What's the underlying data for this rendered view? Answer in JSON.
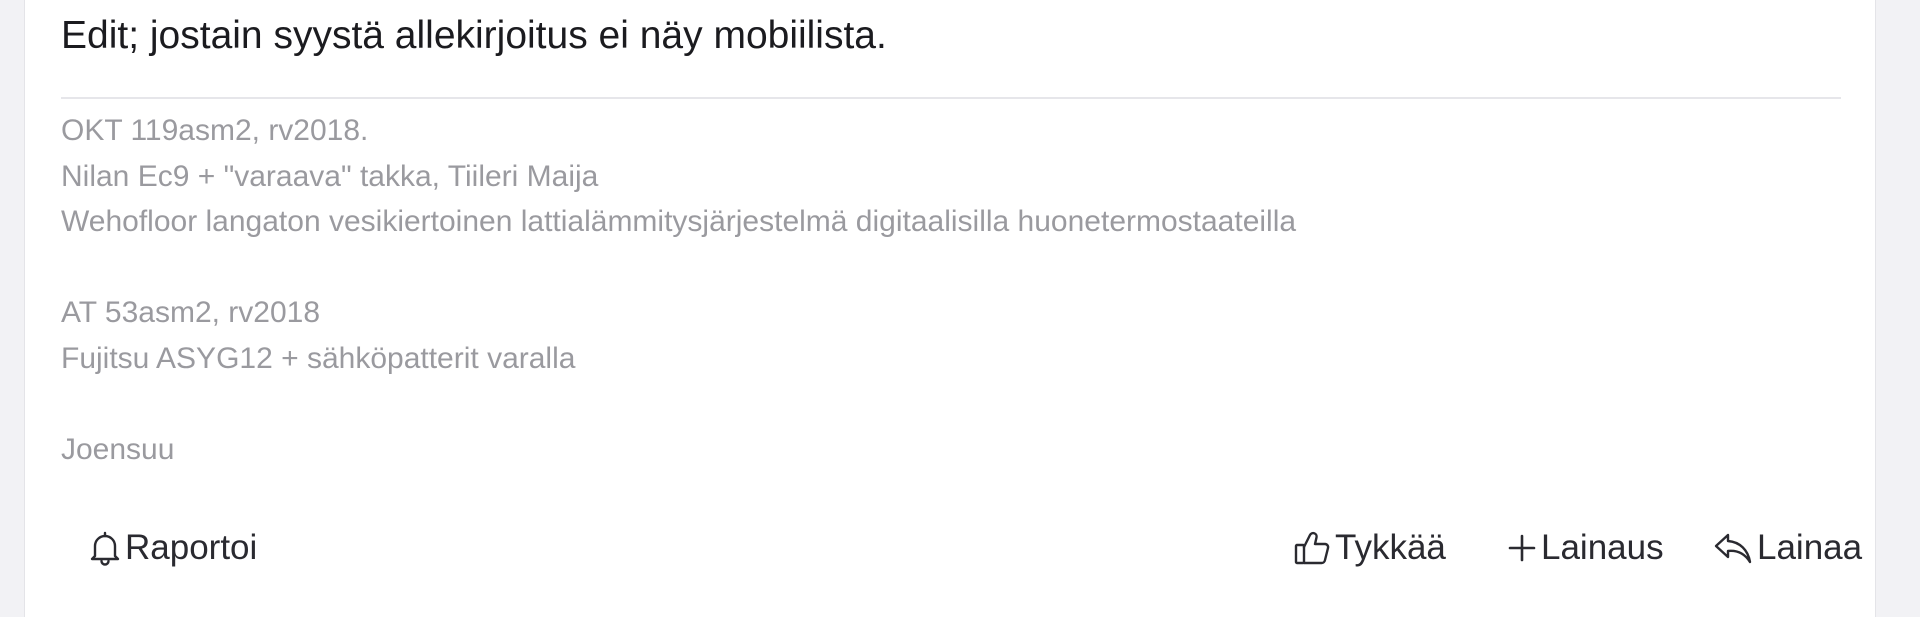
{
  "post": {
    "text": "Edit; jostain syystä allekirjoitus ei näy mobiilista."
  },
  "signature": {
    "lines": [
      "OKT 119asm2, rv2018.",
      "Nilan Ec9 + \"varaava\" takka, Tiileri Maija",
      "Wehofloor langaton vesikiertoinen lattialämmitysjärjestelmä digitaalisilla huonetermostaateilla",
      "",
      "AT 53asm2, rv2018",
      "Fujitsu ASYG12 + sähköpatterit varalla",
      "",
      "Joensuu"
    ]
  },
  "actions": {
    "report_label": "Raportoi",
    "like_label": "Tykkää",
    "quote_label": "Lainaus",
    "reply_label": "Lainaa"
  },
  "icons": {
    "report": "bell-icon",
    "like": "thumbs-up-icon",
    "quote": "plus-icon",
    "reply": "reply-arrow-icon"
  }
}
